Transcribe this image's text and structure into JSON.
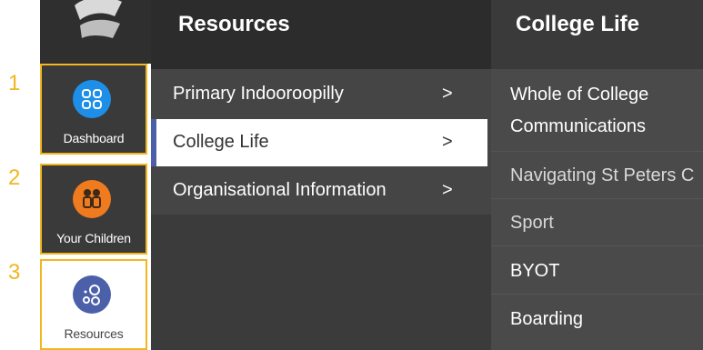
{
  "steps": [
    "1",
    "2",
    "3"
  ],
  "rail": {
    "items": [
      {
        "label": "Dashboard",
        "icon": "dashboard-grid-icon",
        "color": "#1e8fe8"
      },
      {
        "label": "Your Children",
        "icon": "children-icon",
        "color": "#f07a1e"
      },
      {
        "label": "Resources",
        "icon": "resources-icon",
        "color": "#4b60a8"
      }
    ]
  },
  "resources": {
    "title": "Resources",
    "items": [
      {
        "label": "Primary Indooroopilly",
        "chevron": ">"
      },
      {
        "label": "College Life",
        "chevron": ">",
        "active": true
      },
      {
        "label": "Organisational Information",
        "chevron": ">"
      }
    ]
  },
  "college": {
    "title": "College Life",
    "items": [
      {
        "line1": "Whole of College",
        "line2": "Communications"
      },
      {
        "label": "Navigating St Peters C"
      },
      {
        "label": "Sport"
      },
      {
        "label": "BYOT"
      },
      {
        "label": "Boarding"
      }
    ]
  },
  "colors": {
    "highlight": "#f2b61f",
    "accent": "#4b60a8"
  }
}
